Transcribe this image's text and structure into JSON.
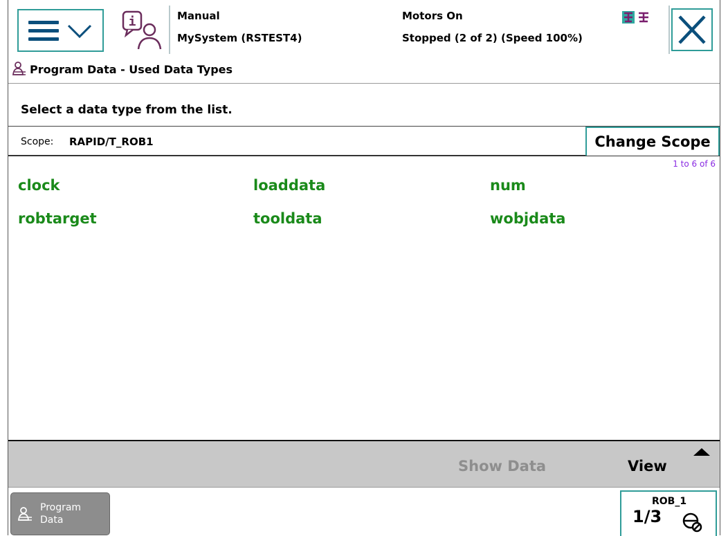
{
  "header": {
    "mode": "Manual",
    "system": "MySystem (RSTEST4)",
    "motors": "Motors On",
    "state": "Stopped (2 of 2) (Speed 100%)",
    "menu_icon": "hamburger-menu-icon",
    "info_icon": "event-log-info-icon",
    "close_icon": "close-icon"
  },
  "view": {
    "title": "Program Data - Used Data Types",
    "instruction": "Select a data type from the list.",
    "scope_label": "Scope:",
    "scope_value": "RAPID/T_ROB1",
    "change_scope": "Change Scope",
    "pager": "1 to 6 of 6",
    "data_types": [
      "clock",
      "loaddata",
      "num",
      "robtarget",
      "tooldata",
      "wobjdata"
    ]
  },
  "commands": {
    "show_data": "Show Data",
    "view": "View"
  },
  "taskbar": {
    "task_label_line1": "Program",
    "task_label_line2": "Data",
    "rob_label": "ROB_1",
    "rob_fraction": "1/3"
  },
  "colors": {
    "accent": "#2f9c98",
    "data_type_text": "#1a8a1a",
    "pager_text": "#8a2be2",
    "command_bar": "#c8c8c8",
    "disabled_text": "#8e8e8e"
  }
}
